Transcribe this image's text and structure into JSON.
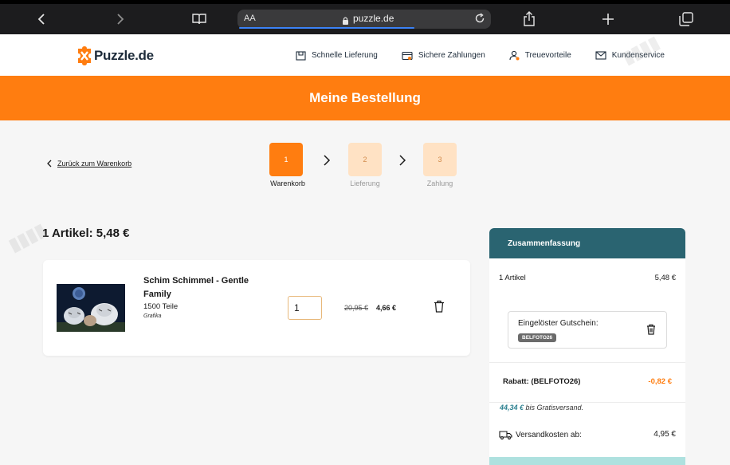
{
  "browser": {
    "reader_label": "AA",
    "url": "puzzle.de"
  },
  "header": {
    "logo_text": "Puzzle.de",
    "usps": [
      {
        "label": "Schnelle Lieferung",
        "icon": "box-icon"
      },
      {
        "label": "Sichere Zahlungen",
        "icon": "credit-card-icon"
      },
      {
        "label": "Treuevorteile",
        "icon": "user-badge-icon"
      },
      {
        "label": "Kundenservice",
        "icon": "mail-icon"
      }
    ]
  },
  "banner": {
    "title": "Meine Bestellung"
  },
  "back_link": {
    "label": "Zurück zum Warenkorb"
  },
  "steps": [
    {
      "number": "1",
      "label": "Warenkorb",
      "state": "active"
    },
    {
      "number": "2",
      "label": "Lieferung",
      "state": "inactive"
    },
    {
      "number": "3",
      "label": "Zahlung",
      "state": "inactive"
    }
  ],
  "cart": {
    "count_title": "1 Artikel: 5,48 €",
    "item": {
      "name": "Schim Schimmel - Gentle Family",
      "pieces": "1500 Teile",
      "brand": "Grafika",
      "quantity": "1",
      "price_old": "20,95 €",
      "price_new": "4,66 €"
    }
  },
  "summary": {
    "title": "Zusammenfassung",
    "items_label": "1 Artikel",
    "items_value": "5,48 €",
    "voucher_title": "Eingelöster Gutschein:",
    "voucher_code": "BELFOTO26",
    "discount_label": "Rabatt: (BELFOTO26)",
    "discount_value": "-0,82 €",
    "free_shipping_amount": "44,34 €",
    "free_shipping_text": " bis Gratisversand.",
    "shipping_label": "Versandkosten ab:",
    "shipping_value": "4,95 €"
  },
  "colors": {
    "brand_orange": "#ff7d10",
    "summary_teal": "#2a6471"
  }
}
